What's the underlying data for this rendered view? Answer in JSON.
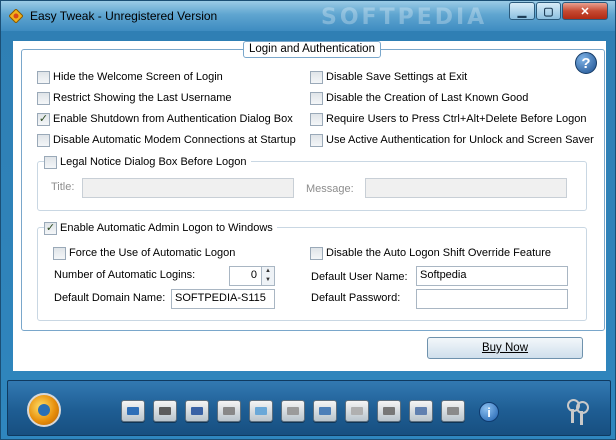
{
  "window": {
    "title": "Easy Tweak - Unregistered Version",
    "watermark": "SOFTPEDIA"
  },
  "group_login": {
    "title": "Login and Authentication",
    "options_left": [
      {
        "label": "Hide the Welcome Screen of Login",
        "checked": false
      },
      {
        "label": "Restrict Showing the Last Username",
        "checked": false
      },
      {
        "label": "Enable Shutdown from Authentication Dialog Box",
        "checked": true
      },
      {
        "label": "Disable Automatic Modem Connections at Startup",
        "checked": false
      }
    ],
    "options_right": [
      {
        "label": "Disable Save Settings at Exit",
        "checked": false
      },
      {
        "label": "Disable the Creation of Last Known Good",
        "checked": false
      },
      {
        "label": "Require Users to Press Ctrl+Alt+Delete Before Logon",
        "checked": false
      },
      {
        "label": "Use Active Authentication for Unlock and Screen Saver",
        "checked": false
      }
    ]
  },
  "legal_notice": {
    "label": "Legal Notice Dialog Box Before Logon",
    "checked": false,
    "title_label": "Title:",
    "title_value": "",
    "message_label": "Message:",
    "message_value": ""
  },
  "admin_logon": {
    "label": "Enable Automatic Admin Logon to Windows",
    "checked": true,
    "force_label": "Force the Use of Automatic Logon",
    "force_checked": false,
    "shift_label": "Disable the Auto Logon Shift Override Feature",
    "shift_checked": false,
    "count_label": "Number of Automatic Logins:",
    "count_value": "0",
    "domain_label": "Default Domain Name:",
    "domain_value": "SOFTPEDIA-S115",
    "user_label": "Default User Name:",
    "user_value": "Softpedia",
    "password_label": "Default Password:",
    "password_value": ""
  },
  "buy_button": "Buy Now",
  "help_icon": "?",
  "toolbar": {
    "info_icon": "i",
    "icons": [
      "tweaks-icon",
      "display-icon",
      "hardware-icon",
      "disk-icon",
      "network-icon",
      "folder-icon",
      "window-icon",
      "tools-icon",
      "files-icon",
      "printer-icon",
      "home-icon",
      "system-icon",
      "info-icon",
      "keys-icon"
    ]
  }
}
